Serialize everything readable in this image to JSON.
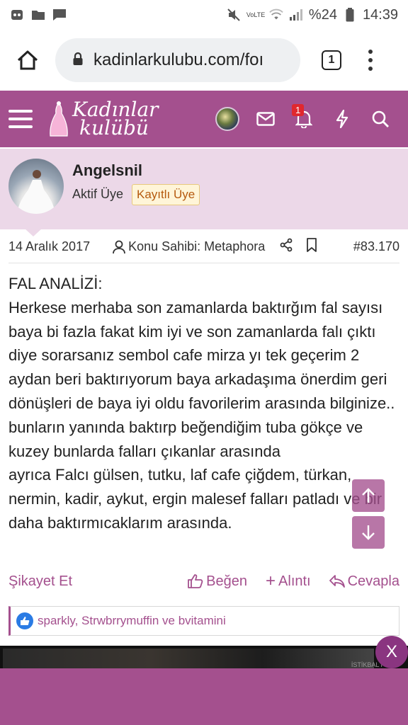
{
  "status_bar": {
    "battery_percent": "%24",
    "time": "14:39",
    "network": "VoLTE"
  },
  "browser": {
    "url": "kadinlarkulubu.com/foı",
    "tab_count": "1"
  },
  "site": {
    "logo_line1": "Kadınlar",
    "logo_line2": "kulübü",
    "notification_count": "1",
    "accent_color": "#a4508e"
  },
  "user": {
    "name": "Angelsnil",
    "role": "Aktif Üye",
    "tag": "Kayıtlı Üye"
  },
  "post_meta": {
    "date": "14 Aralık 2017",
    "owner": "Konu Sahibi: Metaphora",
    "post_number": "#83.170"
  },
  "post_body": [
    "FAL ANALİZİ:",
    "Herkese merhaba son zamanlarda baktırğım fal sayısı baya bi fazla fakat kim iyi ve son zamanlarda falı çıktı diye sorarsanız sembol cafe mirza yı tek geçerim 2 aydan beri baktırıyorum baya arkadaşıma önerdim geri dönüşleri de baya iyi oldu favorilerim arasında bilginize..",
    "bunların yanında baktırp beğendiğim tuba gökçe ve kuzey bunlarda falları çıkanlar arasında",
    "ayrıca Falcı gülsen, tutku, laf cafe çiğdem, türkan, nermin, kadir, aykut, ergin malesef falları patladı ve bir daha baktırmıcaklarım arasında."
  ],
  "actions": {
    "report": "Şikayet Et",
    "like": "Beğen",
    "quote": "Alıntı",
    "reply": "Cevapla"
  },
  "likes_text": "sparkly, Strwbrrymuffin ve bvitamini",
  "ad": {
    "close_label": "X",
    "small_text": "İSTİKBAL PR"
  }
}
